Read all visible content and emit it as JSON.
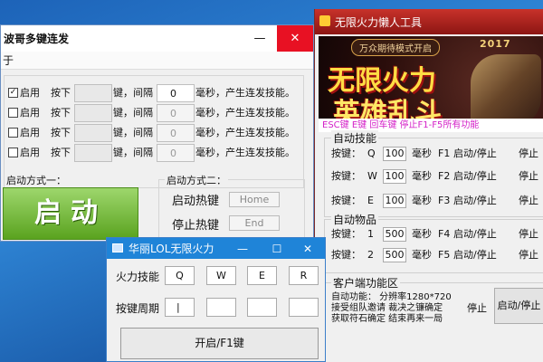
{
  "desktop": {
    "background": "#2f86d6"
  },
  "win1": {
    "title": "波哥多键连发",
    "controls": {
      "minimize": "—",
      "close": "✕"
    },
    "menu": "于",
    "rows": [
      {
        "checked": true,
        "check_label": "启用",
        "press_label": "按下",
        "key": "",
        "key_suffix": "键，间隔",
        "interval": "0",
        "suffix": "毫秒，产生连发技能。"
      },
      {
        "checked": false,
        "check_label": "启用",
        "press_label": "按下",
        "key": "",
        "key_suffix": "键，间隔",
        "interval": "0",
        "suffix": "毫秒，产生连发技能。"
      },
      {
        "checked": false,
        "check_label": "启用",
        "press_label": "按下",
        "key": "",
        "key_suffix": "键，间隔",
        "interval": "0",
        "suffix": "毫秒，产生连发技能。"
      },
      {
        "checked": false,
        "check_label": "启用",
        "press_label": "按下",
        "key": "",
        "key_suffix": "键，间隔",
        "interval": "0",
        "suffix": "毫秒，产生连发技能。"
      }
    ],
    "mode1_label": "启动方式一：",
    "start_button": "启动",
    "mode2_label": "启动方式二：",
    "start_hotkey_label": "启动热键",
    "start_hotkey": "Home",
    "stop_hotkey_label": "停止热键",
    "stop_hotkey": "End"
  },
  "win2": {
    "title": "无限火力懒人工具",
    "banner": {
      "pill": "万众期待模式开启",
      "year": "2017",
      "headline1": "无限火力",
      "headline2": "英雄乱斗",
      "strip": "ESC键 E键 回车键  停止F1-F5所有功能"
    },
    "skills": {
      "label": "自动技能",
      "rows": [
        {
          "key_label": "按键：",
          "key": "Q",
          "interval": "100",
          "unit": "毫秒",
          "hotkey": "F1",
          "toggle": "启动/停止",
          "state": "停止"
        },
        {
          "key_label": "按键：",
          "key": "W",
          "interval": "100",
          "unit": "毫秒",
          "hotkey": "F2",
          "toggle": "启动/停止",
          "state": "停止"
        },
        {
          "key_label": "按键：",
          "key": "E",
          "interval": "100",
          "unit": "毫秒",
          "hotkey": "F3",
          "toggle": "启动/停止",
          "state": "停止"
        }
      ]
    },
    "items": {
      "label": "自动物品",
      "rows": [
        {
          "key_label": "按键：",
          "key": "1",
          "interval": "500",
          "unit": "毫秒",
          "hotkey": "F4",
          "toggle": "启动/停止",
          "state": "停止"
        },
        {
          "key_label": "按键：",
          "key": "2",
          "interval": "500",
          "unit": "毫秒",
          "hotkey": "F5",
          "toggle": "启动/停止",
          "state": "停止"
        }
      ]
    },
    "client": {
      "label": "客户端功能区",
      "line1": "自动功能：  分辨率1280*720",
      "line2": "接受组队邀请  裁决之镰确定",
      "line3": "获取符石确定  结束再来一局",
      "state": "停止",
      "button": "启动/停止"
    }
  },
  "win3": {
    "title": "华丽LOL无限火力",
    "controls": {
      "minimize": "—",
      "maximize": "☐",
      "close": "✕"
    },
    "skill_label": "火力技能",
    "skill_keys": [
      "Q",
      "W",
      "E",
      "R"
    ],
    "period_label": "按键周期",
    "period_values": [
      "|",
      "",
      "",
      ""
    ],
    "start_button": "开启/F1键"
  }
}
